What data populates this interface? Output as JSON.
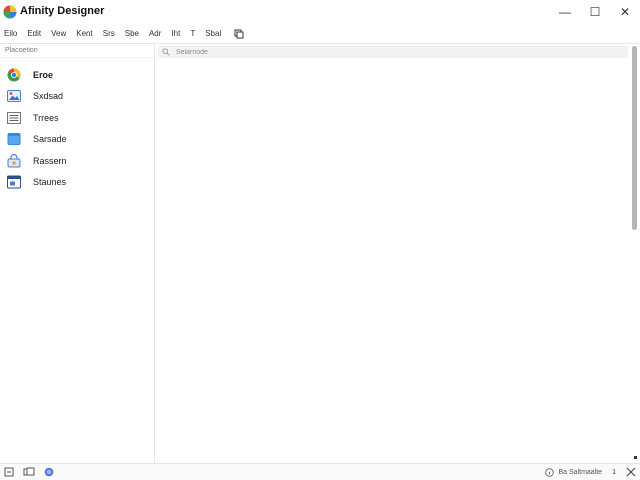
{
  "app": {
    "title": "Afinity Designer"
  },
  "window_controls": {
    "minimize": "—",
    "maximize": "☐",
    "close": "✕"
  },
  "menu": {
    "items": [
      "Eilo",
      "Edit",
      "Vew",
      "Kent",
      "Srs",
      "Sbe",
      "Adr",
      "Iht",
      "T",
      "Sbal"
    ]
  },
  "sidebar": {
    "header": "Placoetion",
    "items": [
      {
        "label": "Eroe",
        "icon": "chrome-icon"
      },
      {
        "label": "Sxdsad",
        "icon": "image-icon"
      },
      {
        "label": "Trrees",
        "icon": "list-icon"
      },
      {
        "label": "Sarsade",
        "icon": "folder-icon"
      },
      {
        "label": "Rassern",
        "icon": "lock-icon"
      },
      {
        "label": "Staunes",
        "icon": "window-icon"
      }
    ]
  },
  "search": {
    "placeholder": "Selarnode"
  },
  "status": {
    "left_icons": [
      "new-file-icon",
      "copy-icon",
      "globe-icon"
    ],
    "text": "Ba Saltmaalte",
    "page": "1",
    "zoom_icon": "resize-icon"
  },
  "colors": {
    "accent": "#3b7ddd",
    "scrollbar": "#b5b5b5",
    "search_bg": "#f3f3f3"
  }
}
